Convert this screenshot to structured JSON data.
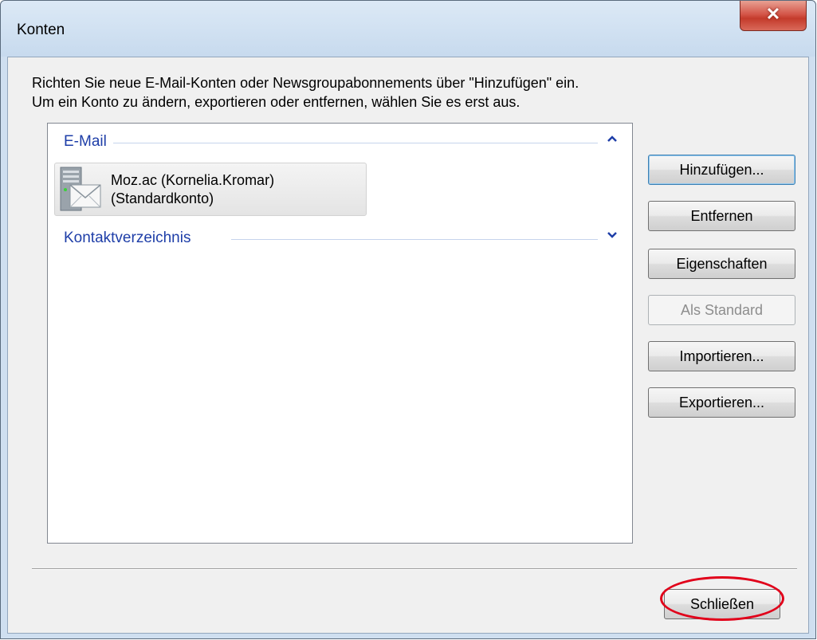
{
  "window": {
    "title": "Konten",
    "close_glyph": "✕"
  },
  "instructions": {
    "line1": "Richten Sie neue E-Mail-Konten oder Newsgroupabonnements über \"Hinzufügen\" ein.",
    "line2": "Um ein Konto zu ändern, exportieren oder entfernen, wählen Sie es erst aus."
  },
  "groups": [
    {
      "label": "E-Mail",
      "state": "expanded",
      "items": [
        {
          "name": "Moz.ac (Kornelia.Kromar)",
          "subtitle": "(Standardkonto)",
          "icon": "mail-server-icon"
        }
      ]
    },
    {
      "label": "Kontaktverzeichnis",
      "state": "collapsed",
      "items": []
    }
  ],
  "buttons": {
    "add": "Hinzufügen...",
    "remove": "Entfernen",
    "properties": "Eigenschaften",
    "set_default": "Als Standard",
    "import": "Importieren...",
    "export": "Exportieren...",
    "close": "Schließen"
  },
  "colors": {
    "group_header": "#1e3ea8",
    "highlight_ring": "#e1001a",
    "close_button": "#c43b2b"
  }
}
